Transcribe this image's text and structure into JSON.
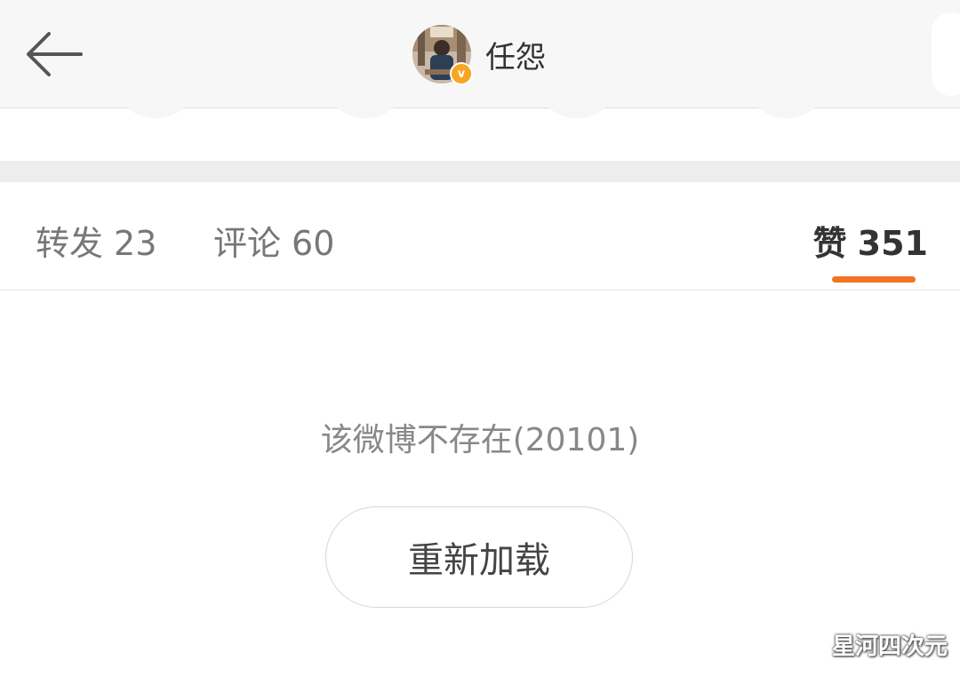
{
  "header": {
    "username": "任怨",
    "verified_badge": "v",
    "back_icon": "arrow-left-icon"
  },
  "tabs": [
    {
      "label": "转发",
      "count": "23",
      "active": false
    },
    {
      "label": "评论",
      "count": "60",
      "active": false
    },
    {
      "label": "赞",
      "count": "351",
      "active": true
    }
  ],
  "content": {
    "error_message": "该微博不存在(20101)",
    "reload_label": "重新加载"
  },
  "watermark": "星河四次元",
  "colors": {
    "accent": "#f27321",
    "verified": "#f5a623",
    "header_bg": "#f7f7f7",
    "band": "#ededed"
  }
}
